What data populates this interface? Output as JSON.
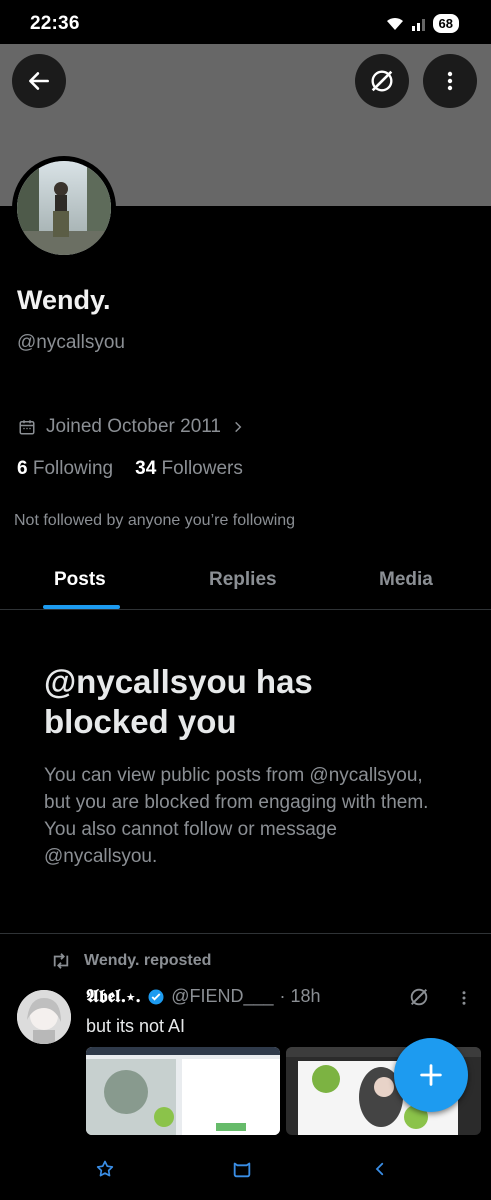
{
  "status_bar": {
    "time": "22:36",
    "battery": "68"
  },
  "profile": {
    "display_name": "Wendy.",
    "handle": "@nycallsyou",
    "joined": "Joined October 2011",
    "following_count": "6",
    "following_label": "Following",
    "followers_count": "34",
    "followers_label": "Followers",
    "not_followed_text": "Not followed by anyone you’re following"
  },
  "tabs": [
    {
      "label": "Posts",
      "active": true
    },
    {
      "label": "Replies",
      "active": false
    },
    {
      "label": "Media",
      "active": false
    }
  ],
  "blocked": {
    "title": "@nycallsyou has blocked you",
    "description": "You can view public posts from @nycallsyou, but you are blocked from engaging with them. You also cannot follow or message @nycallsyou."
  },
  "post": {
    "repost_label": "Wendy. reposted",
    "author_name": "𝕬𝖇𝖊𝖑.⋆.",
    "author_handle": "@FIEND___",
    "time": "· 18h",
    "text": "but its not AI",
    "verified": true
  },
  "colors": {
    "accent": "#1d9bf0",
    "banner": "#676767",
    "muted_text": "#8b8f94",
    "background": "#000000"
  },
  "icons": [
    "back-arrow-icon",
    "grok-icon",
    "more-vertical-icon",
    "calendar-icon",
    "chevron-right-icon",
    "repost-icon",
    "verified-badge-icon",
    "plus-icon",
    "star-icon",
    "home-icon",
    "back-nav-icon"
  ]
}
